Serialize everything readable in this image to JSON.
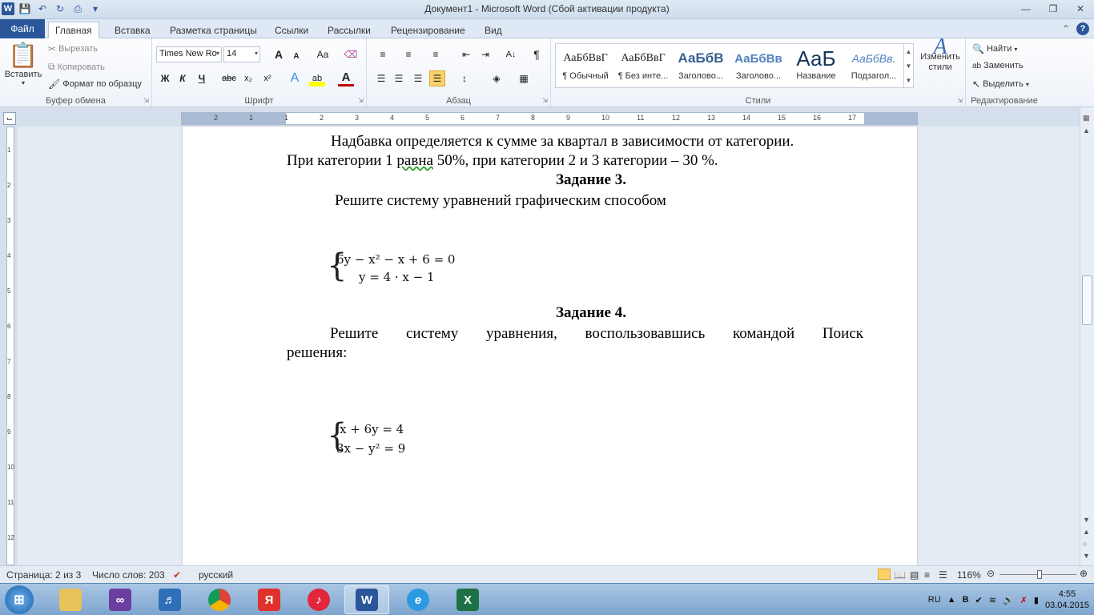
{
  "window": {
    "title": "Документ1  -  Microsoft Word (Сбой активации продукта)",
    "word_logo": "W"
  },
  "tabs": {
    "file": "Файл",
    "items": [
      "Главная",
      "Вставка",
      "Разметка страницы",
      "Ссылки",
      "Рассылки",
      "Рецензирование",
      "Вид"
    ],
    "active_index": 0
  },
  "clipboard": {
    "paste": "Вставить",
    "cut": "Вырезать",
    "copy": "Копировать",
    "format_painter": "Формат по образцу",
    "label": "Буфер обмена"
  },
  "font": {
    "name": "Times New Ro",
    "size": "14",
    "label": "Шрифт",
    "bold": "Ж",
    "italic": "К",
    "underline": "Ч",
    "strike": "abc",
    "subscript": "x₂",
    "superscript": "x²",
    "grow": "A",
    "shrink": "A",
    "case": "Aa",
    "text_effects": "A",
    "highlight": "ab",
    "font_color": "A"
  },
  "paragraph": {
    "label": "Абзац",
    "pilcrow": "¶"
  },
  "styles": {
    "label": "Стили",
    "items": [
      {
        "sample": "АаБбВвГ",
        "name": "¶ Обычный"
      },
      {
        "sample": "АаБбВвГ",
        "name": "¶ Без инте..."
      },
      {
        "sample": "АаБбВ",
        "name": "Заголово..."
      },
      {
        "sample": "АаБбВв",
        "name": "Заголово..."
      },
      {
        "sample": "АаБ",
        "name": "Название"
      },
      {
        "sample": "АаБбВв.",
        "name": "Подзагол..."
      }
    ],
    "change_styles_line1": "Изменить",
    "change_styles_line2": "стили"
  },
  "editing": {
    "label": "Редактирование",
    "find": "Найти",
    "replace": "Заменить",
    "select": "Выделить"
  },
  "ruler": {
    "ticks": [
      "2",
      "1",
      "1",
      "2",
      "3",
      "4",
      "5",
      "6",
      "7",
      "8",
      "9",
      "10",
      "11",
      "12",
      "13",
      "14",
      "15",
      "16",
      "17"
    ],
    "vticks": [
      "1",
      "2",
      "3",
      "4",
      "5",
      "6",
      "7",
      "8",
      "9",
      "10",
      "11",
      "12"
    ]
  },
  "document": {
    "p1_line1": "Надбавка определяется к сумме за квартал в зависимости от категории.",
    "p1_line2_a": "При категории 1 ",
    "p1_line2_b": "равна",
    "p1_line2_c": " 50%, при категории 2 и 3 категории – 30 %.",
    "task3_title": "Задание 3.",
    "task3_text": "Решите систему уравнений графическим способом",
    "eq1_line1": "6y − x² − x + 6 = 0",
    "eq1_line2": "y = 4 · x − 1",
    "task4_title": "Задание 4.",
    "task4_line1": "Решите систему уравнения, воспользовавшись командой Поиск",
    "task4_line2": "решения:",
    "eq2_line1": "x + 6y = 4",
    "eq2_line2": "3x − y² = 9"
  },
  "status": {
    "page": "Страница: 2 из 3",
    "words": "Число слов: 203",
    "language": "русский",
    "zoom": "116%"
  },
  "taskbar": {
    "lang": "RU",
    "time": "4:55",
    "date": "03.04.2015",
    "yandex": "Я",
    "word": "W",
    "excel": "X"
  }
}
